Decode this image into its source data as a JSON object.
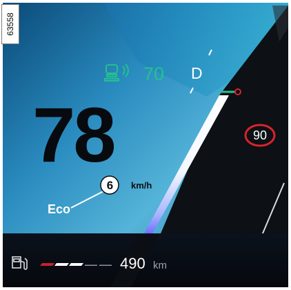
{
  "reference_code": "63558",
  "cruise": {
    "target_speed": "70"
  },
  "gear": "D",
  "speedometer": {
    "speed": "78",
    "unit": "km/h"
  },
  "callout": {
    "number": "6"
  },
  "drive_mode": "Eco",
  "speed_limit": {
    "value": "90"
  },
  "fuel": {
    "range_value": "490",
    "range_unit": "km",
    "fill_segments": 3,
    "total_segments": 5
  },
  "icons": {
    "cruise": "adaptive-cruise-control-icon",
    "fuel": "fuel-pump-icon",
    "limit": "speed-limit-sign-icon"
  },
  "colors": {
    "accent_green": "#22c28e",
    "limit_red": "#d9232d",
    "fuel_red": "#c8202a"
  }
}
